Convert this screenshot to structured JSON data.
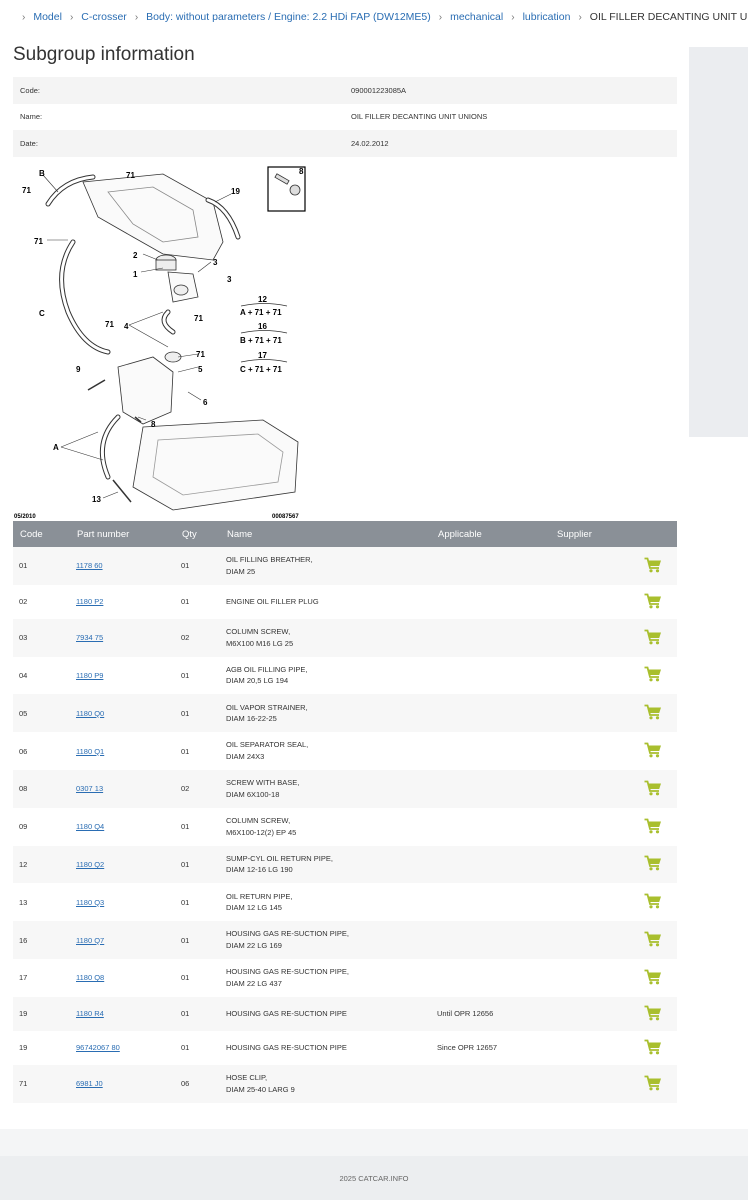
{
  "breadcrumb": {
    "items": [
      "Model",
      "C-crosser",
      "Body: without parameters / Engine: 2.2 HDi FAP (DW12ME5)",
      "mechanical",
      "lubrication"
    ],
    "current": "OIL FILLER DECANTING UNIT UNIONS"
  },
  "page": {
    "title": "Subgroup information"
  },
  "info": [
    {
      "key": "Code:",
      "value": "090001223085A"
    },
    {
      "key": "Name:",
      "value": "OIL FILLER DECANTING UNIT UNIONS"
    },
    {
      "key": "Date:",
      "value": "24.02.2012"
    }
  ],
  "diagram": {
    "date_label": "05/2010",
    "ref_label": "00087567",
    "callouts": [
      "B",
      "71",
      "71",
      "19",
      "8",
      "71",
      "2",
      "3",
      "1",
      "3",
      "C",
      "71",
      "4",
      "71",
      "71",
      "9",
      "5",
      "6",
      "8",
      "A",
      "13"
    ],
    "kits": [
      {
        "number": "12",
        "formula": "A + 71 + 71"
      },
      {
        "number": "16",
        "formula": "B + 71 + 71"
      },
      {
        "number": "17",
        "formula": "C + 71 + 71"
      }
    ]
  },
  "table": {
    "headers": [
      "Code",
      "Part number",
      "Qty",
      "Name",
      "Applicable",
      "Supplier",
      ""
    ],
    "rows": [
      {
        "code": "01",
        "pn": "1178 60",
        "qty": "01",
        "name1": "OIL FILLING BREATHER,",
        "name2": "DIAM 25",
        "applicable": ""
      },
      {
        "code": "02",
        "pn": "1180 P2",
        "qty": "01",
        "name1": "ENGINE OIL FILLER PLUG",
        "name2": "",
        "applicable": ""
      },
      {
        "code": "03",
        "pn": "7934 75",
        "qty": "02",
        "name1": "COLUMN SCREW,",
        "name2": "M6X100 M16 LG 25",
        "applicable": ""
      },
      {
        "code": "04",
        "pn": "1180 P9",
        "qty": "01",
        "name1": "AGB OIL FILLING PIPE,",
        "name2": "DIAM 20,5 LG 194",
        "applicable": ""
      },
      {
        "code": "05",
        "pn": "1180 Q0",
        "qty": "01",
        "name1": "OIL VAPOR STRAINER,",
        "name2": "DIAM 16-22-25",
        "applicable": ""
      },
      {
        "code": "06",
        "pn": "1180 Q1",
        "qty": "01",
        "name1": "OIL SEPARATOR SEAL,",
        "name2": "DIAM 24X3",
        "applicable": ""
      },
      {
        "code": "08",
        "pn": "0307 13",
        "qty": "02",
        "name1": "SCREW WITH BASE,",
        "name2": "DIAM 6X100-18",
        "applicable": ""
      },
      {
        "code": "09",
        "pn": "1180 Q4",
        "qty": "01",
        "name1": "COLUMN SCREW,",
        "name2": "M6X100-12(2) EP 45",
        "applicable": ""
      },
      {
        "code": "12",
        "pn": "1180 Q2",
        "qty": "01",
        "name1": "SUMP-CYL OIL RETURN PIPE,",
        "name2": "DIAM 12-16 LG 190",
        "applicable": ""
      },
      {
        "code": "13",
        "pn": "1180 Q3",
        "qty": "01",
        "name1": "OIL RETURN PIPE,",
        "name2": "DIAM 12 LG 145",
        "applicable": ""
      },
      {
        "code": "16",
        "pn": "1180 Q7",
        "qty": "01",
        "name1": "HOUSING GAS RE-SUCTION PIPE,",
        "name2": "DIAM 22 LG 169",
        "applicable": ""
      },
      {
        "code": "17",
        "pn": "1180 Q8",
        "qty": "01",
        "name1": "HOUSING GAS RE-SUCTION PIPE,",
        "name2": "DIAM 22 LG 437",
        "applicable": ""
      },
      {
        "code": "19",
        "pn": "1180 R4",
        "qty": "01",
        "name1": "HOUSING GAS RE-SUCTION PIPE",
        "name2": "",
        "applicable": "Until OPR 12656"
      },
      {
        "code": "19",
        "pn": "96742067 80",
        "qty": "01",
        "name1": "HOUSING GAS RE-SUCTION PIPE",
        "name2": "",
        "applicable": "Since OPR 12657"
      },
      {
        "code": "71",
        "pn": "6981 J0",
        "qty": "06",
        "name1": "HOSE CLIP,",
        "name2": "DIAM 25-40 LARG 9",
        "applicable": ""
      }
    ]
  },
  "footer": {
    "text": "2025 CATCAR.INFO"
  },
  "colors": {
    "link": "#2a6db3",
    "cart": "#a9bf2e",
    "header_bg": "#8a9097"
  },
  "icons": {
    "home": "home-icon",
    "cart": "cart-icon"
  }
}
